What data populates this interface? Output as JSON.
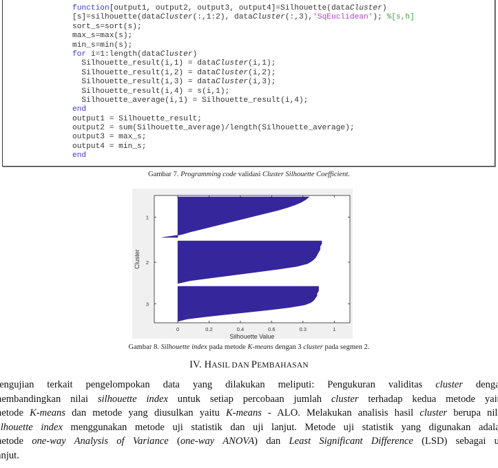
{
  "code_block": {
    "language": "matlab",
    "lines": [
      [
        {
          "t": "function",
          "c": "kw"
        },
        {
          "t": "[output1, output2, output3, output4]=Silhouette(data"
        },
        {
          "t": "Cluster",
          "c": "it"
        },
        {
          "t": ")"
        }
      ],
      [
        {
          "t": "[s]=silhouette(data"
        },
        {
          "t": "Cluster",
          "c": "it"
        },
        {
          "t": "(:,1:2), data"
        },
        {
          "t": "Cluster",
          "c": "it"
        },
        {
          "t": "(:,3),"
        },
        {
          "t": "'SqEuclidean'",
          "c": "str"
        },
        {
          "t": "); "
        },
        {
          "t": "%[s,h]",
          "c": "cmt"
        }
      ],
      [
        {
          "t": "sort_s=sort(s);"
        }
      ],
      [
        {
          "t": "max_s=max(s);"
        }
      ],
      [
        {
          "t": "min_s=min(s);"
        }
      ],
      [
        {
          "t": "for",
          "c": "kw"
        },
        {
          "t": " i=1:length(data"
        },
        {
          "t": "Cluster",
          "c": "it"
        },
        {
          "t": ")"
        }
      ],
      [
        {
          "t": "  Silhouette_result(i,1) = data"
        },
        {
          "t": "Cluster",
          "c": "it"
        },
        {
          "t": "(i,1);"
        }
      ],
      [
        {
          "t": "  Silhouette_result(i,2) = data"
        },
        {
          "t": "Cluster",
          "c": "it"
        },
        {
          "t": "(i,2);"
        }
      ],
      [
        {
          "t": "  Silhouette_result(i,3) = data"
        },
        {
          "t": "Cluster",
          "c": "it"
        },
        {
          "t": "(i,3);"
        }
      ],
      [
        {
          "t": "  Silhouette_result(i,4) = s(i,1);"
        }
      ],
      [
        {
          "t": "  Silhouette_average(i,1) = Silhouette_result(i,4);"
        }
      ],
      [
        {
          "t": "end",
          "c": "kw"
        }
      ],
      [
        {
          "t": "output1 = Silhouette_result;"
        }
      ],
      [
        {
          "t": "output2 = sum(Silhouette_average)/length(Silhouette_average);"
        }
      ],
      [
        {
          "t": "output3 = max_s;"
        }
      ],
      [
        {
          "t": "output4 = min_s;"
        }
      ],
      [
        {
          "t": "end",
          "c": "kw"
        }
      ]
    ]
  },
  "figure7_caption": {
    "prefix": "Gambar 7. ",
    "italic1": "Programming code",
    "mid": " validasi ",
    "italic2": "Cluster Silhouette Coefficient",
    "suffix": "."
  },
  "chart_data": {
    "type": "silhouette",
    "title": "",
    "xlabel": "Silhouette Value",
    "ylabel": "Cluster",
    "xlim": [
      -0.15,
      1.1
    ],
    "x_ticks": [
      0,
      0.2,
      0.4,
      0.6,
      0.8,
      1
    ],
    "x_tick_labels": [
      "0",
      "0.2",
      "0.4",
      "0.6",
      "0.3",
      "1"
    ],
    "y_tick_labels": [
      "1",
      "2",
      "3"
    ],
    "bar_color": "#36269c",
    "clusters": [
      {
        "label": "1",
        "profile_max_to_min": [
          0.84,
          0.82,
          0.79,
          0.75,
          0.7,
          0.64,
          0.57,
          0.5,
          0.43,
          0.36,
          0.29,
          0.22,
          0.15,
          0.08,
          0.02,
          -0.1
        ]
      },
      {
        "label": "2",
        "profile_max_to_min": [
          0.92,
          0.92,
          0.91,
          0.91,
          0.9,
          0.89,
          0.88,
          0.86,
          0.83,
          0.76,
          0.64,
          0.5,
          0.36,
          0.22,
          0.08,
          0.0
        ]
      },
      {
        "label": "3",
        "profile_max_to_min": [
          0.9,
          0.9,
          0.9,
          0.89,
          0.89,
          0.88,
          0.87,
          0.85,
          0.81,
          0.72,
          0.6,
          0.46,
          0.32,
          0.18,
          0.06,
          0.0
        ]
      }
    ]
  },
  "figure8_caption": {
    "prefix": "Gambar 8. ",
    "italic1": "Silhouette index",
    "mid1": " pada metode ",
    "italic2": "K-means",
    "mid2": " dengan 3 ",
    "italic3": "cluster",
    "suffix": " pada segmen 2."
  },
  "section": {
    "numeral": "IV. ",
    "w1_cap": "H",
    "w1_rest": "ASIL",
    "w2": " DAN ",
    "w3_cap": "P",
    "w3_rest": "EMBAHASAN"
  },
  "paragraph": {
    "lines": [
      [
        {
          "t": "Pengujian terkait pengelompokan data yang dilakukan meliputi: Pengukuran validitas "
        },
        {
          "t": "cluster",
          "i": true
        },
        {
          "t": " dengan"
        }
      ],
      [
        {
          "t": "membandingkan nilai "
        },
        {
          "t": "silhouette index",
          "i": true
        },
        {
          "t": " untuk setiap percobaan jumlah "
        },
        {
          "t": "cluster",
          "i": true
        },
        {
          "t": " terhadap kedua metode yaitu"
        }
      ],
      [
        {
          "t": "metode "
        },
        {
          "t": "K-means",
          "i": true
        },
        {
          "t": " dan metode yang diusulkan yaitu "
        },
        {
          "t": "K-means",
          "i": true
        },
        {
          "t": " - ALO. Melakukan analisis hasil "
        },
        {
          "t": "cluster",
          "i": true
        },
        {
          "t": " berupa nilai"
        }
      ],
      [
        {
          "t": "silhouette index",
          "i": true
        },
        {
          "t": " menggunakan metode uji statistik dan uji lanjut. Metode uji statistik yang digunakan adalah"
        }
      ],
      [
        {
          "t": "metode "
        },
        {
          "t": "one-way Analysis of Variance",
          "i": true
        },
        {
          "t": " ("
        },
        {
          "t": "one-way ANOVA",
          "i": true
        },
        {
          "t": ") dan "
        },
        {
          "t": "Least Significant Difference",
          "i": true
        },
        {
          "t": " (LSD) sebagai uji"
        }
      ],
      [
        {
          "t": "lanjut."
        }
      ]
    ]
  }
}
